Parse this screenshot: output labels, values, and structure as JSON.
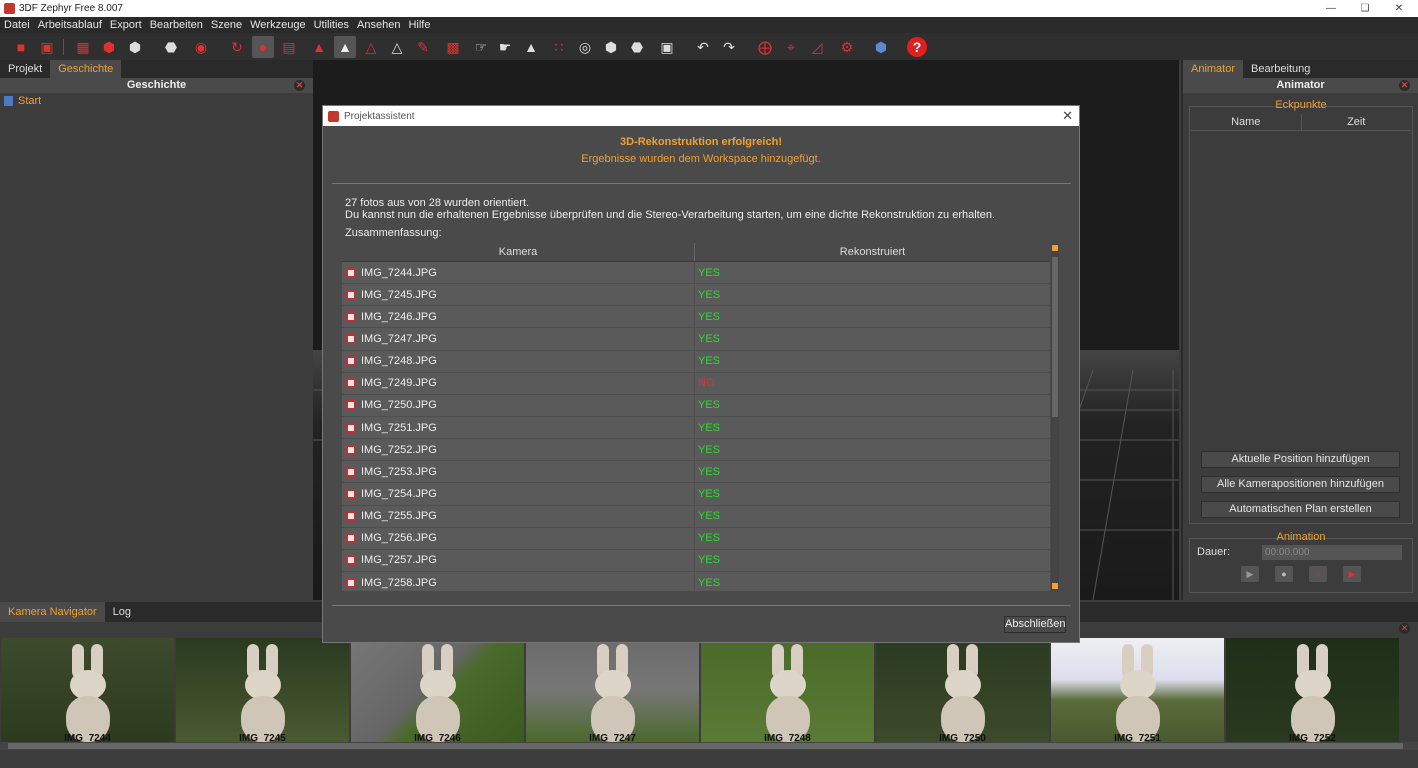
{
  "window": {
    "title": "3DF Zephyr Free 8.007"
  },
  "menu": [
    "Datei",
    "Arbeitsablauf",
    "Export",
    "Bearbeiten",
    "Szene",
    "Werkzeuge",
    "Utilities",
    "Ansehen",
    "Hilfe"
  ],
  "left_panel": {
    "tabs": [
      "Projekt",
      "Geschichte"
    ],
    "active_tab": "Geschichte",
    "header": "Geschichte",
    "items": [
      "Start"
    ]
  },
  "right_panel": {
    "tabs": [
      "Animator",
      "Bearbeitung"
    ],
    "active_tab": "Animator",
    "header": "Animator",
    "keypoints": {
      "title": "Eckpunkte",
      "col_name": "Name",
      "col_time": "Zeit"
    },
    "buttons": [
      "Aktuelle Position hinzufügen",
      "Alle Kamerapositionen hinzufügen",
      "Automatischen Plan erstellen"
    ],
    "animation": {
      "title": "Animation",
      "duration_label": "Dauer:",
      "duration_value": "00:00.000"
    }
  },
  "bottom_panel": {
    "tabs": [
      "Kamera Navigator",
      "Log"
    ],
    "active_tab": "Kamera Navigator",
    "thumbnails": [
      "IMG_7244",
      "IMG_7245",
      "IMG_7246",
      "IMG_7247",
      "IMG_7248",
      "IMG_7250",
      "IMG_7251",
      "IMG_7252"
    ]
  },
  "dialog": {
    "title": "Projektassistent",
    "heading": "3D-Rekonstruktion erfolgreich!",
    "subheading": "Ergebnisse wurden dem Workspace hinzugefügt.",
    "info_line1": "27 fotos aus von 28 wurden orientiert.",
    "info_line2": "Du kannst nun die erhaltenen Ergebnisse überprüfen und die Stereo-Verarbeitung starten, um eine dichte Rekonstruktion zu erhalten.",
    "summary_label": "Zusammenfassung:",
    "columns": [
      "Kamera",
      "Rekonstruiert"
    ],
    "rows": [
      {
        "camera": "IMG_7244.JPG",
        "status": "YES"
      },
      {
        "camera": "IMG_7245.JPG",
        "status": "YES"
      },
      {
        "camera": "IMG_7246.JPG",
        "status": "YES"
      },
      {
        "camera": "IMG_7247.JPG",
        "status": "YES"
      },
      {
        "camera": "IMG_7248.JPG",
        "status": "YES"
      },
      {
        "camera": "IMG_7249.JPG",
        "status": "NO"
      },
      {
        "camera": "IMG_7250.JPG",
        "status": "YES"
      },
      {
        "camera": "IMG_7251.JPG",
        "status": "YES"
      },
      {
        "camera": "IMG_7252.JPG",
        "status": "YES"
      },
      {
        "camera": "IMG_7253.JPG",
        "status": "YES"
      },
      {
        "camera": "IMG_7254.JPG",
        "status": "YES"
      },
      {
        "camera": "IMG_7255.JPG",
        "status": "YES"
      },
      {
        "camera": "IMG_7256.JPG",
        "status": "YES"
      },
      {
        "camera": "IMG_7257.JPG",
        "status": "YES"
      },
      {
        "camera": "IMG_7258.JPG",
        "status": "YES"
      }
    ],
    "finish_button": "Abschließen"
  },
  "colors": {
    "accent": "#f0a030",
    "yes": "#2cdc2c",
    "no": "#e03030"
  }
}
